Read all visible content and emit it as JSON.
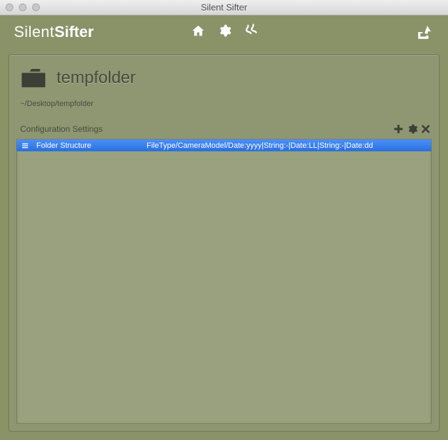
{
  "window": {
    "title": "Silent Sifter"
  },
  "logo": {
    "part1": "Silent",
    "part2": "Sifter"
  },
  "folder": {
    "name": "tempfolder",
    "path": "~/Desktop/tempfolder"
  },
  "config": {
    "heading": "Configuration Settings",
    "rows": [
      {
        "label": "Folder Structure",
        "value": "FileType/CameraModel/Date:yyyy|String:-|Date:LL|String:-|Date:dd"
      }
    ]
  }
}
